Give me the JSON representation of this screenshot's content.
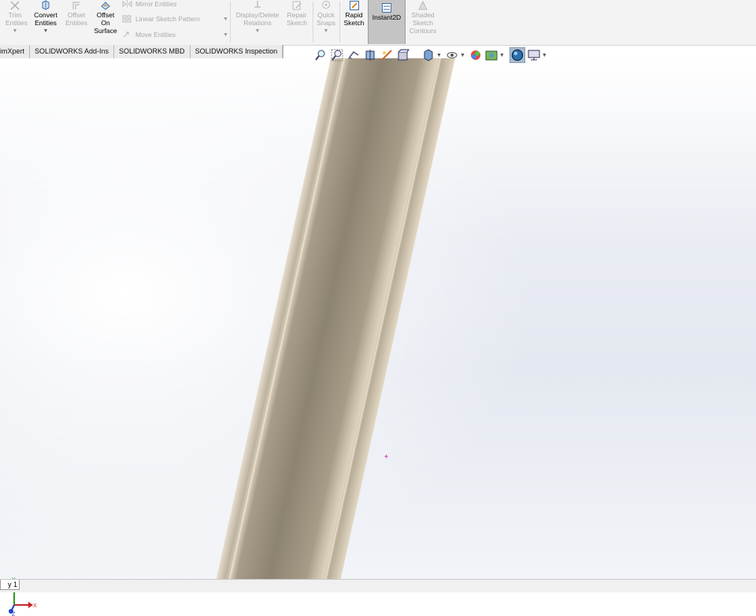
{
  "ribbon": {
    "trim_entities": "Trim Entities",
    "convert_entities": "Convert Entities",
    "offset_entities": "Offset Entities",
    "offset_on_surface": "Offset On Surface",
    "mirror_entities": "Mirror Entities",
    "linear_sketch_pattern": "Linear Sketch Pattern",
    "move_entities": "Move Entities",
    "display_delete_relations": "Display/Delete Relations",
    "repair_sketch": "Repair Sketch",
    "quick_snaps": "Quick Snaps",
    "rapid_sketch": "Rapid Sketch",
    "instant2d": "Instant2D",
    "shaded_sketch_contours": "Shaded Sketch Contours"
  },
  "tabs": [
    "imXpert",
    "SOLIDWORKS Add-Ins",
    "SOLIDWORKS MBD",
    "SOLIDWORKS Inspection"
  ],
  "status": {
    "sheet_tab": "y 1"
  },
  "colors": {
    "ribbon_bg": "#f3f3f3",
    "tube": "#a89d8b",
    "origin": "#cc22aa"
  }
}
